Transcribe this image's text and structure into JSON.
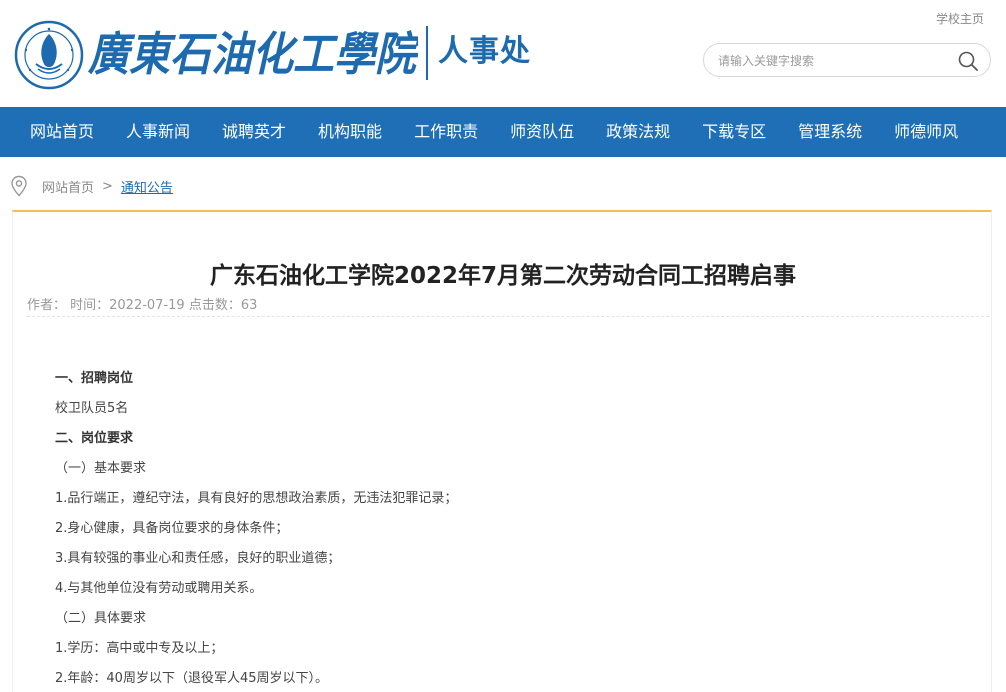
{
  "header": {
    "school_name_script": "廣東石油化工學院",
    "department": "人事处",
    "home_link": "学校主页",
    "search": {
      "placeholder": "请输入关键字搜索",
      "icon": "search-icon"
    },
    "colors": {
      "brand_blue": "#1e6aae",
      "nav_blue": "#1e6fb6",
      "accent_orange": "#f3bf58"
    }
  },
  "nav": {
    "items": [
      {
        "label": "网站首页"
      },
      {
        "label": "人事新闻"
      },
      {
        "label": "诚聘英才"
      },
      {
        "label": "机构职能"
      },
      {
        "label": "工作职责"
      },
      {
        "label": "师资队伍"
      },
      {
        "label": "政策法规"
      },
      {
        "label": "下载专区"
      },
      {
        "label": "管理系统"
      },
      {
        "label": "师德师风"
      }
    ]
  },
  "breadcrumb": {
    "icon": "location-pin-icon",
    "home": "网站首页",
    "separator": ">",
    "current": "通知公告"
  },
  "article": {
    "title": "广东石油化工学院2022年7月第二次劳动合同工招聘启事",
    "meta": "作者： 时间：2022-07-19 点击数：63",
    "paragraphs": [
      {
        "text": "一、招聘岗位",
        "bold": true
      },
      {
        "text": "校卫队员5名",
        "bold": false
      },
      {
        "text": "二、岗位要求",
        "bold": true
      },
      {
        "text": "（一）基本要求",
        "bold": false
      },
      {
        "text": "1.品行端正，遵纪守法，具有良好的思想政治素质，无违法犯罪记录；",
        "bold": false
      },
      {
        "text": "2.身心健康，具备岗位要求的身体条件；",
        "bold": false
      },
      {
        "text": "3.具有较强的事业心和责任感，良好的职业道德；",
        "bold": false
      },
      {
        "text": "4.与其他单位没有劳动或聘用关系。",
        "bold": false
      },
      {
        "text": "（二）具体要求",
        "bold": false
      },
      {
        "text": "1.学历：高中或中专及以上；",
        "bold": false
      },
      {
        "text": "2.年龄：40周岁以下（退役军人45周岁以下）。",
        "bold": false
      }
    ]
  }
}
